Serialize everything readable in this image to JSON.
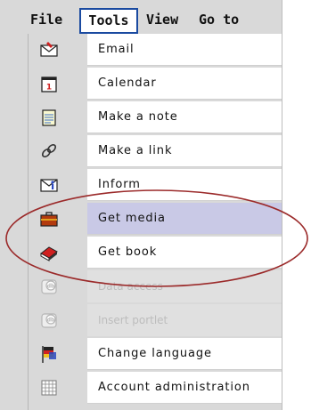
{
  "menubar": {
    "file": "File",
    "tools": "Tools",
    "view": "View",
    "goto": "Go to"
  },
  "menu": {
    "items": [
      {
        "label": "Email",
        "icon": "email-icon",
        "state": "normal"
      },
      {
        "label": "Calendar",
        "icon": "calendar-icon",
        "state": "normal"
      },
      {
        "label": "Make a note",
        "icon": "note-icon",
        "state": "normal"
      },
      {
        "label": "Make a link",
        "icon": "link-icon",
        "state": "normal"
      },
      {
        "label": "Inform",
        "icon": "inform-icon",
        "state": "normal"
      },
      {
        "label": "Get media",
        "icon": "briefcase-icon",
        "state": "selected"
      },
      {
        "label": "Get book",
        "icon": "book-icon",
        "state": "normal"
      },
      {
        "label": "Data access",
        "icon": "database-icon",
        "state": "disabled"
      },
      {
        "label": "Insert portlet",
        "icon": "database-icon",
        "state": "disabled"
      },
      {
        "label": "Change language",
        "icon": "flags-icon",
        "state": "normal"
      },
      {
        "label": "Account administration",
        "icon": "grid-icon",
        "state": "normal"
      }
    ]
  },
  "colors": {
    "selected_row": "#c9c9e6",
    "annotation_ellipse": "#9b2a2a",
    "menubar_highlight": "#1a4aa0"
  },
  "calendar_icon_day": "1"
}
